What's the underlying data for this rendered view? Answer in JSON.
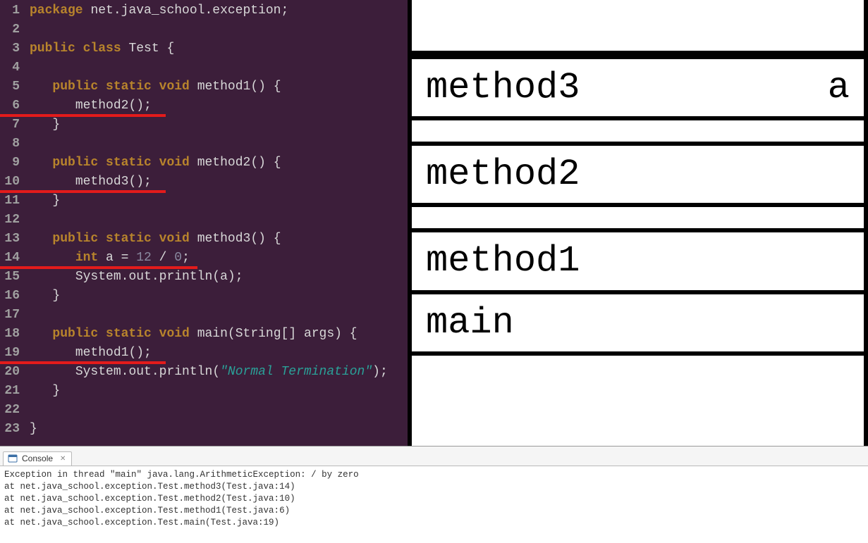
{
  "editor": {
    "lines": [
      {
        "n": 1,
        "tokens": [
          [
            "kw1",
            "package"
          ],
          [
            "punc",
            " "
          ],
          [
            "pkg",
            "net.java_school.exception"
          ],
          [
            "punc",
            ";"
          ]
        ]
      },
      {
        "n": 2,
        "tokens": []
      },
      {
        "n": 3,
        "tokens": [
          [
            "kw1",
            "public"
          ],
          [
            "punc",
            " "
          ],
          [
            "kw1",
            "class"
          ],
          [
            "punc",
            " "
          ],
          [
            "clsname",
            "Test"
          ],
          [
            "punc",
            " {"
          ]
        ]
      },
      {
        "n": 4,
        "tokens": []
      },
      {
        "n": 5,
        "tokens": [
          [
            "punc",
            "   "
          ],
          [
            "kw1",
            "public"
          ],
          [
            "punc",
            " "
          ],
          [
            "kw1",
            "static"
          ],
          [
            "punc",
            " "
          ],
          [
            "kw1",
            "void"
          ],
          [
            "punc",
            " "
          ],
          [
            "methodname",
            "method1"
          ],
          [
            "punc",
            "() {"
          ]
        ]
      },
      {
        "n": 6,
        "tokens": [
          [
            "punc",
            "      "
          ],
          [
            "methodname",
            "method2"
          ],
          [
            "punc",
            "();"
          ]
        ],
        "underline": 235
      },
      {
        "n": 7,
        "tokens": [
          [
            "punc",
            "   }"
          ]
        ]
      },
      {
        "n": 8,
        "tokens": []
      },
      {
        "n": 9,
        "tokens": [
          [
            "punc",
            "   "
          ],
          [
            "kw1",
            "public"
          ],
          [
            "punc",
            " "
          ],
          [
            "kw1",
            "static"
          ],
          [
            "punc",
            " "
          ],
          [
            "kw1",
            "void"
          ],
          [
            "punc",
            " "
          ],
          [
            "methodname",
            "method2"
          ],
          [
            "punc",
            "() {"
          ]
        ]
      },
      {
        "n": 10,
        "tokens": [
          [
            "punc",
            "      "
          ],
          [
            "methodname",
            "method3"
          ],
          [
            "punc",
            "();"
          ]
        ],
        "underline": 235
      },
      {
        "n": 11,
        "tokens": [
          [
            "punc",
            "   }"
          ]
        ]
      },
      {
        "n": 12,
        "tokens": []
      },
      {
        "n": 13,
        "tokens": [
          [
            "punc",
            "   "
          ],
          [
            "kw1",
            "public"
          ],
          [
            "punc",
            " "
          ],
          [
            "kw1",
            "static"
          ],
          [
            "punc",
            " "
          ],
          [
            "kw1",
            "void"
          ],
          [
            "punc",
            " "
          ],
          [
            "methodname",
            "method3"
          ],
          [
            "punc",
            "() {"
          ]
        ]
      },
      {
        "n": 14,
        "tokens": [
          [
            "punc",
            "      "
          ],
          [
            "kw1",
            "int"
          ],
          [
            "punc",
            " "
          ],
          [
            "ident",
            "a"
          ],
          [
            "punc",
            " = "
          ],
          [
            "num",
            "12"
          ],
          [
            "punc",
            " / "
          ],
          [
            "num",
            "0"
          ],
          [
            "punc",
            ";"
          ]
        ],
        "underline": 280
      },
      {
        "n": 15,
        "tokens": [
          [
            "punc",
            "      "
          ],
          [
            "sys",
            "System"
          ],
          [
            "punc",
            "."
          ],
          [
            "ident",
            "out"
          ],
          [
            "punc",
            "."
          ],
          [
            "methodname",
            "println"
          ],
          [
            "punc",
            "("
          ],
          [
            "ident",
            "a"
          ],
          [
            "punc",
            ");"
          ]
        ]
      },
      {
        "n": 16,
        "tokens": [
          [
            "punc",
            "   }"
          ]
        ]
      },
      {
        "n": 17,
        "tokens": []
      },
      {
        "n": 18,
        "tokens": [
          [
            "punc",
            "   "
          ],
          [
            "kw1",
            "public"
          ],
          [
            "punc",
            " "
          ],
          [
            "kw1",
            "static"
          ],
          [
            "punc",
            " "
          ],
          [
            "kw1",
            "void"
          ],
          [
            "punc",
            " "
          ],
          [
            "methodname",
            "main"
          ],
          [
            "punc",
            "("
          ],
          [
            "ident",
            "String"
          ],
          [
            "punc",
            "[] "
          ],
          [
            "ident",
            "args"
          ],
          [
            "punc",
            ") {"
          ]
        ]
      },
      {
        "n": 19,
        "tokens": [
          [
            "punc",
            "      "
          ],
          [
            "methodname",
            "method1"
          ],
          [
            "punc",
            "();"
          ]
        ],
        "underline": 235
      },
      {
        "n": 20,
        "tokens": [
          [
            "punc",
            "      "
          ],
          [
            "sys",
            "System"
          ],
          [
            "punc",
            "."
          ],
          [
            "ident",
            "out"
          ],
          [
            "punc",
            "."
          ],
          [
            "methodname",
            "println"
          ],
          [
            "punc",
            "("
          ],
          [
            "str",
            "\"Normal Termination\""
          ],
          [
            "punc",
            ");"
          ]
        ]
      },
      {
        "n": 21,
        "tokens": [
          [
            "punc",
            "   }"
          ]
        ]
      },
      {
        "n": 22,
        "tokens": []
      },
      {
        "n": 23,
        "tokens": [
          [
            "punc",
            "}"
          ]
        ]
      }
    ]
  },
  "stack": {
    "frames": [
      {
        "label": "method3",
        "var": "a"
      },
      {
        "label": "method2",
        "var": ""
      },
      {
        "label": "method1",
        "var": ""
      },
      {
        "label": "main",
        "var": ""
      }
    ]
  },
  "console": {
    "tab_label": "Console",
    "close_glyph": "✕",
    "lines": [
      "Exception in thread \"main\" java.lang.ArithmeticException: / by zero",
      "at net.java_school.exception.Test.method3(Test.java:14)",
      "at net.java_school.exception.Test.method2(Test.java:10)",
      "at net.java_school.exception.Test.method1(Test.java:6)",
      "at net.java_school.exception.Test.main(Test.java:19)"
    ]
  }
}
